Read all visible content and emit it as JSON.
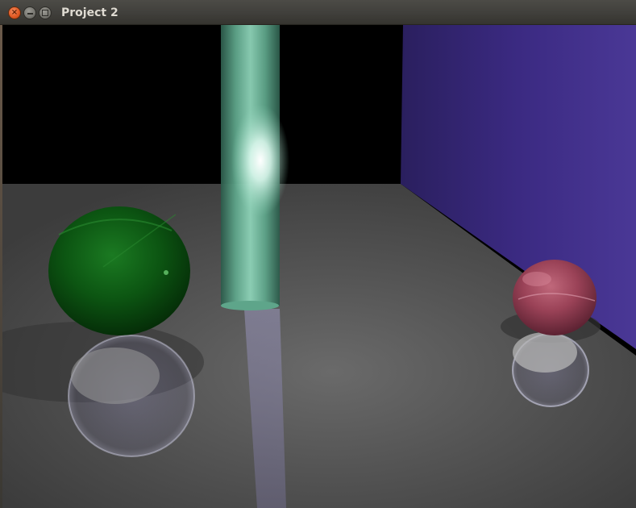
{
  "window": {
    "title": "Project 2",
    "buttons": {
      "close_icon": "close-icon",
      "minimize_icon": "minimize-icon",
      "maximize_icon": "maximize-icon"
    }
  },
  "scene": {
    "objects": [
      "green-sphere",
      "glass-cylinder",
      "red-sphere",
      "purple-wall",
      "gray-floor"
    ],
    "colors": {
      "floor": "#4e4e4e",
      "wall": "#3e2e84",
      "green_sphere": "#0a5a10",
      "red_sphere": "#a5485c",
      "cylinder": "#7fc6ac",
      "background": "#000000"
    }
  }
}
